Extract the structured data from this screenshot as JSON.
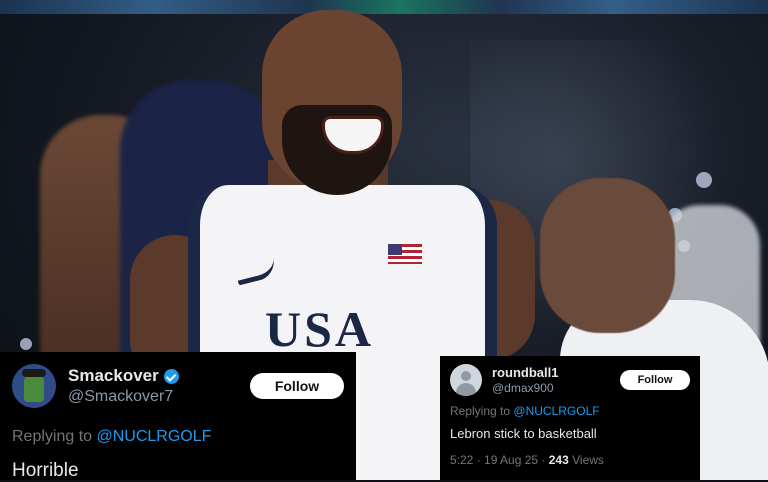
{
  "tweets": [
    {
      "display_name": "Smackover",
      "handle": "@Smackover7",
      "verified": true,
      "follow_label": "Follow",
      "replying_prefix": "Replying to",
      "replying_to": "@NUCLRGOLF",
      "text": "Horrible",
      "avatar_icon": "cartoon-avatar-icon"
    },
    {
      "display_name": "roundball1",
      "handle": "@dmax900",
      "verified": false,
      "follow_label": "Follow",
      "replying_prefix": "Replying to",
      "replying_to": "@NUCLRGOLF",
      "text": "Lebron stick to basketball",
      "time": "5:22 · 19 Aug 25 ·",
      "views_count": "243",
      "views_label": "Views",
      "avatar_icon": "default-avatar-icon"
    }
  ],
  "photo": {
    "jersey_text": "USA",
    "accent_navy": "#1c2645",
    "link_color": "#1d9bf0"
  }
}
